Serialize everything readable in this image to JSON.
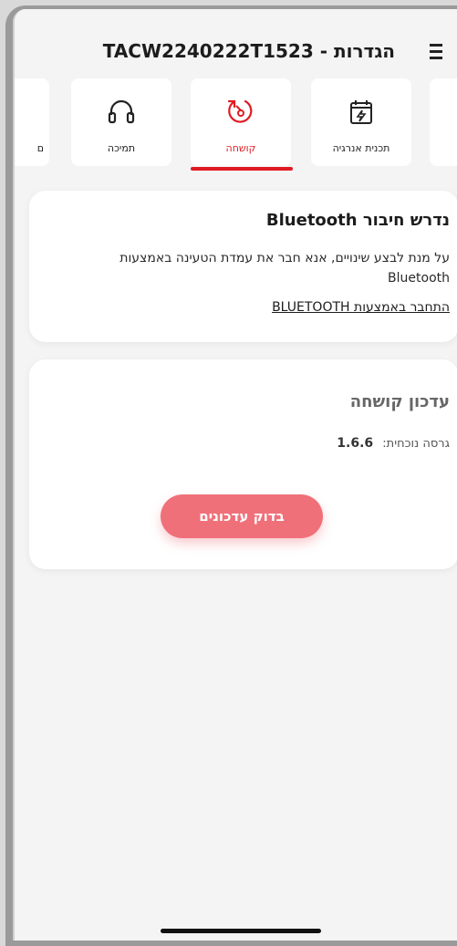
{
  "header": {
    "title": "הגדרות - TACW2240222T1523"
  },
  "tabs": [
    {
      "label": "ם",
      "icon": "partial-tab-icon",
      "active": false
    },
    {
      "label": "תכנית אנרגיה",
      "icon": "calendar-bolt-icon",
      "active": false
    },
    {
      "label": "קושחה",
      "icon": "firmware-update-icon",
      "active": true
    },
    {
      "label": "תמיכה",
      "icon": "headset-icon",
      "active": false
    }
  ],
  "bluetooth": {
    "title": "נדרש חיבור Bluetooth",
    "description": "על מנת לבצע שינויים, אנא חבר את עמדת הטעינה באמצעות Bluetooth",
    "link": "התחבר באמצעות BLUETOOTH"
  },
  "firmware": {
    "title": "עדכון קושחה",
    "version_label": "גרסה נוכחית:",
    "version_value": "1.6.6",
    "check_button": "בדוק עדכונים"
  },
  "colors": {
    "accent": "#e01b23",
    "button": "#f0707a",
    "background": "#f4f4f4"
  }
}
